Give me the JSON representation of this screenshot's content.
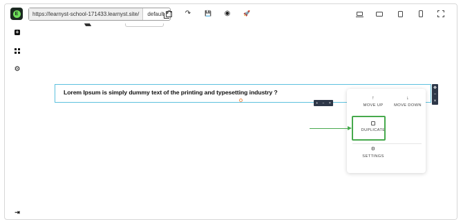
{
  "topbar": {
    "logo_icon": "elementor-logo-icon",
    "logo_letter": "E",
    "url": "https://learnyst-school-171433.learnyst.site/",
    "environment": "default",
    "copy_icon": "copy-icon",
    "actions": [
      "undo-icon",
      "redo-icon",
      "save-icon",
      "preview-eye-icon",
      "publish-rocket-icon"
    ],
    "action_glyphs": {
      "undo": "↶",
      "redo": "↷",
      "save": "💾",
      "preview": "◉",
      "publish": "🚀"
    },
    "devices": [
      "desktop-icon",
      "tablet-landscape-icon",
      "tablet-portrait-icon",
      "mobile-icon",
      "fullscreen-icon"
    ]
  },
  "sidebar": {
    "items": [
      "add-element-icon",
      "widgets-grid-icon",
      "settings-gear-icon"
    ],
    "bottom": "exit-icon",
    "glyphs": {
      "settings": "⚙",
      "exit": "⇥"
    }
  },
  "canvas": {
    "text_block": "Lorem Ipsum is simply dummy text of the printing and typesetting industry ?",
    "mini_toolbar": [
      "+",
      "−",
      "×"
    ],
    "right_bar": [
      "✥",
      "−",
      "×"
    ]
  },
  "popup": {
    "move_up_icon": "↑",
    "move_up": "MOVE UP",
    "move_down_icon": "↓",
    "move_down": "MOVE DOWN",
    "duplicate": "DUPLICATE",
    "settings_icon": "⚙",
    "settings": "SETTINGS"
  },
  "colors": {
    "highlight": "#46a94c",
    "selection": "#5bc0de",
    "toolbar_dark": "#2d3748",
    "logo_green": "#6ee05a"
  }
}
